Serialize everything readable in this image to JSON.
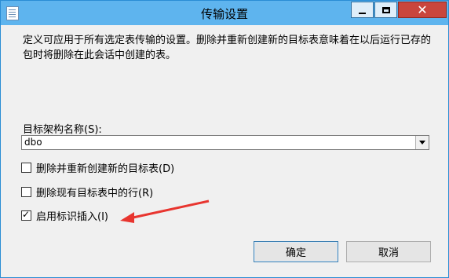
{
  "window": {
    "title": "传输设置",
    "controls": {
      "close_glyph": "✕"
    }
  },
  "description": "定义可应用于所有选定表传输的设置。删除并重新创建新的目标表意味着在以后运行已存的包时将删除在此会话中创建的表。",
  "schema": {
    "label": "目标架构名称(S):",
    "value": "dbo"
  },
  "options": [
    {
      "label": "删除并重新创建新的目标表(D)",
      "checked": false
    },
    {
      "label": "删除现有目标表中的行(R)",
      "checked": false
    },
    {
      "label": "启用标识插入(I)",
      "checked": true
    }
  ],
  "buttons": {
    "ok": "确定",
    "cancel": "取消"
  },
  "colors": {
    "titlebar": "#5eb4ee",
    "close": "#c9463d",
    "annotation_arrow": "#e8352f"
  },
  "icons": [
    "app-icon",
    "minimize-icon",
    "maximize-icon",
    "close-icon",
    "dropdown-arrow-icon",
    "red-annotation-arrow"
  ]
}
